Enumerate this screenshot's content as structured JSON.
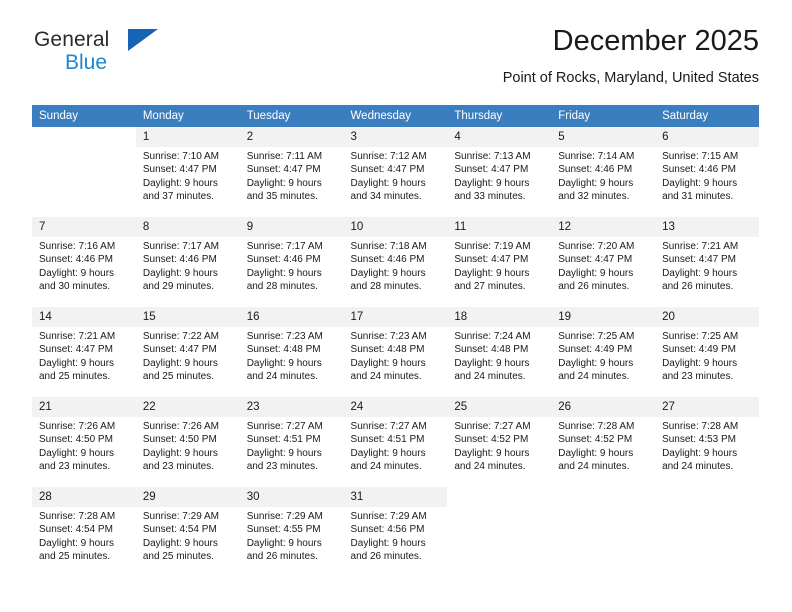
{
  "brand": {
    "name_top": "General",
    "name_bottom": "Blue",
    "triangle_color": "#1565b4",
    "bottom_color": "#1f86d0"
  },
  "header": {
    "title": "December 2025",
    "subtitle": "Point of Rocks, Maryland, United States"
  },
  "theme": {
    "header_row_bg": "#3a7ec0",
    "header_row_text": "#ffffff",
    "daynum_bg": "#f2f2f2",
    "cell_bg": "#ffffff",
    "text": "#1a1a1a"
  },
  "weekdays": [
    "Sunday",
    "Monday",
    "Tuesday",
    "Wednesday",
    "Thursday",
    "Friday",
    "Saturday"
  ],
  "labels": {
    "sunrise_prefix": "Sunrise: ",
    "sunset_prefix": "Sunset: ",
    "daylight_prefix": "Daylight: "
  },
  "weeks": [
    [
      {
        "empty": true
      },
      {
        "day": "1",
        "sunrise": "Sunrise: 7:10 AM",
        "sunset": "Sunset: 4:47 PM",
        "daylight1": "Daylight: 9 hours",
        "daylight2": "and 37 minutes."
      },
      {
        "day": "2",
        "sunrise": "Sunrise: 7:11 AM",
        "sunset": "Sunset: 4:47 PM",
        "daylight1": "Daylight: 9 hours",
        "daylight2": "and 35 minutes."
      },
      {
        "day": "3",
        "sunrise": "Sunrise: 7:12 AM",
        "sunset": "Sunset: 4:47 PM",
        "daylight1": "Daylight: 9 hours",
        "daylight2": "and 34 minutes."
      },
      {
        "day": "4",
        "sunrise": "Sunrise: 7:13 AM",
        "sunset": "Sunset: 4:47 PM",
        "daylight1": "Daylight: 9 hours",
        "daylight2": "and 33 minutes."
      },
      {
        "day": "5",
        "sunrise": "Sunrise: 7:14 AM",
        "sunset": "Sunset: 4:46 PM",
        "daylight1": "Daylight: 9 hours",
        "daylight2": "and 32 minutes."
      },
      {
        "day": "6",
        "sunrise": "Sunrise: 7:15 AM",
        "sunset": "Sunset: 4:46 PM",
        "daylight1": "Daylight: 9 hours",
        "daylight2": "and 31 minutes."
      }
    ],
    [
      {
        "day": "7",
        "sunrise": "Sunrise: 7:16 AM",
        "sunset": "Sunset: 4:46 PM",
        "daylight1": "Daylight: 9 hours",
        "daylight2": "and 30 minutes."
      },
      {
        "day": "8",
        "sunrise": "Sunrise: 7:17 AM",
        "sunset": "Sunset: 4:46 PM",
        "daylight1": "Daylight: 9 hours",
        "daylight2": "and 29 minutes."
      },
      {
        "day": "9",
        "sunrise": "Sunrise: 7:17 AM",
        "sunset": "Sunset: 4:46 PM",
        "daylight1": "Daylight: 9 hours",
        "daylight2": "and 28 minutes."
      },
      {
        "day": "10",
        "sunrise": "Sunrise: 7:18 AM",
        "sunset": "Sunset: 4:46 PM",
        "daylight1": "Daylight: 9 hours",
        "daylight2": "and 28 minutes."
      },
      {
        "day": "11",
        "sunrise": "Sunrise: 7:19 AM",
        "sunset": "Sunset: 4:47 PM",
        "daylight1": "Daylight: 9 hours",
        "daylight2": "and 27 minutes."
      },
      {
        "day": "12",
        "sunrise": "Sunrise: 7:20 AM",
        "sunset": "Sunset: 4:47 PM",
        "daylight1": "Daylight: 9 hours",
        "daylight2": "and 26 minutes."
      },
      {
        "day": "13",
        "sunrise": "Sunrise: 7:21 AM",
        "sunset": "Sunset: 4:47 PM",
        "daylight1": "Daylight: 9 hours",
        "daylight2": "and 26 minutes."
      }
    ],
    [
      {
        "day": "14",
        "sunrise": "Sunrise: 7:21 AM",
        "sunset": "Sunset: 4:47 PM",
        "daylight1": "Daylight: 9 hours",
        "daylight2": "and 25 minutes."
      },
      {
        "day": "15",
        "sunrise": "Sunrise: 7:22 AM",
        "sunset": "Sunset: 4:47 PM",
        "daylight1": "Daylight: 9 hours",
        "daylight2": "and 25 minutes."
      },
      {
        "day": "16",
        "sunrise": "Sunrise: 7:23 AM",
        "sunset": "Sunset: 4:48 PM",
        "daylight1": "Daylight: 9 hours",
        "daylight2": "and 24 minutes."
      },
      {
        "day": "17",
        "sunrise": "Sunrise: 7:23 AM",
        "sunset": "Sunset: 4:48 PM",
        "daylight1": "Daylight: 9 hours",
        "daylight2": "and 24 minutes."
      },
      {
        "day": "18",
        "sunrise": "Sunrise: 7:24 AM",
        "sunset": "Sunset: 4:48 PM",
        "daylight1": "Daylight: 9 hours",
        "daylight2": "and 24 minutes."
      },
      {
        "day": "19",
        "sunrise": "Sunrise: 7:25 AM",
        "sunset": "Sunset: 4:49 PM",
        "daylight1": "Daylight: 9 hours",
        "daylight2": "and 24 minutes."
      },
      {
        "day": "20",
        "sunrise": "Sunrise: 7:25 AM",
        "sunset": "Sunset: 4:49 PM",
        "daylight1": "Daylight: 9 hours",
        "daylight2": "and 23 minutes."
      }
    ],
    [
      {
        "day": "21",
        "sunrise": "Sunrise: 7:26 AM",
        "sunset": "Sunset: 4:50 PM",
        "daylight1": "Daylight: 9 hours",
        "daylight2": "and 23 minutes."
      },
      {
        "day": "22",
        "sunrise": "Sunrise: 7:26 AM",
        "sunset": "Sunset: 4:50 PM",
        "daylight1": "Daylight: 9 hours",
        "daylight2": "and 23 minutes."
      },
      {
        "day": "23",
        "sunrise": "Sunrise: 7:27 AM",
        "sunset": "Sunset: 4:51 PM",
        "daylight1": "Daylight: 9 hours",
        "daylight2": "and 23 minutes."
      },
      {
        "day": "24",
        "sunrise": "Sunrise: 7:27 AM",
        "sunset": "Sunset: 4:51 PM",
        "daylight1": "Daylight: 9 hours",
        "daylight2": "and 24 minutes."
      },
      {
        "day": "25",
        "sunrise": "Sunrise: 7:27 AM",
        "sunset": "Sunset: 4:52 PM",
        "daylight1": "Daylight: 9 hours",
        "daylight2": "and 24 minutes."
      },
      {
        "day": "26",
        "sunrise": "Sunrise: 7:28 AM",
        "sunset": "Sunset: 4:52 PM",
        "daylight1": "Daylight: 9 hours",
        "daylight2": "and 24 minutes."
      },
      {
        "day": "27",
        "sunrise": "Sunrise: 7:28 AM",
        "sunset": "Sunset: 4:53 PM",
        "daylight1": "Daylight: 9 hours",
        "daylight2": "and 24 minutes."
      }
    ],
    [
      {
        "day": "28",
        "sunrise": "Sunrise: 7:28 AM",
        "sunset": "Sunset: 4:54 PM",
        "daylight1": "Daylight: 9 hours",
        "daylight2": "and 25 minutes."
      },
      {
        "day": "29",
        "sunrise": "Sunrise: 7:29 AM",
        "sunset": "Sunset: 4:54 PM",
        "daylight1": "Daylight: 9 hours",
        "daylight2": "and 25 minutes."
      },
      {
        "day": "30",
        "sunrise": "Sunrise: 7:29 AM",
        "sunset": "Sunset: 4:55 PM",
        "daylight1": "Daylight: 9 hours",
        "daylight2": "and 26 minutes."
      },
      {
        "day": "31",
        "sunrise": "Sunrise: 7:29 AM",
        "sunset": "Sunset: 4:56 PM",
        "daylight1": "Daylight: 9 hours",
        "daylight2": "and 26 minutes."
      },
      {
        "empty": true
      },
      {
        "empty": true
      },
      {
        "empty": true
      }
    ]
  ]
}
